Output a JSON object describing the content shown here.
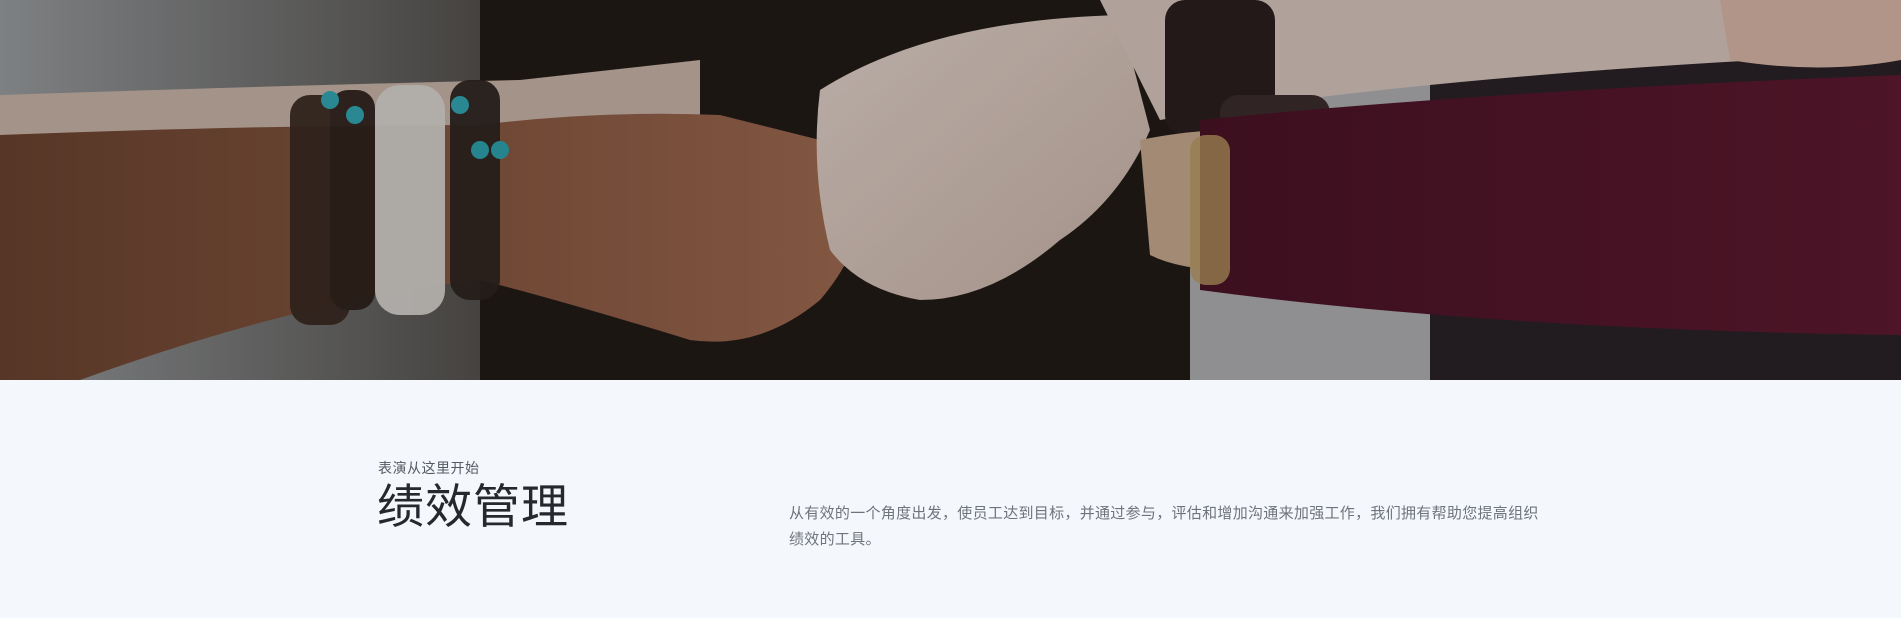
{
  "hero": {
    "image_alt": "团队成员拳头相碰的照片"
  },
  "section": {
    "kicker": "表演从这里开始",
    "title": "绩效管理",
    "description": "从有效的一个角度出发，使员工达到目标，并通过参与，评估和增加沟通来加强工作，我们拥有帮助您提高组织绩效的工具。"
  },
  "colors": {
    "background": "#f4f7fb",
    "title": "#25292e",
    "kicker": "#555a60",
    "description": "#6f747a"
  }
}
